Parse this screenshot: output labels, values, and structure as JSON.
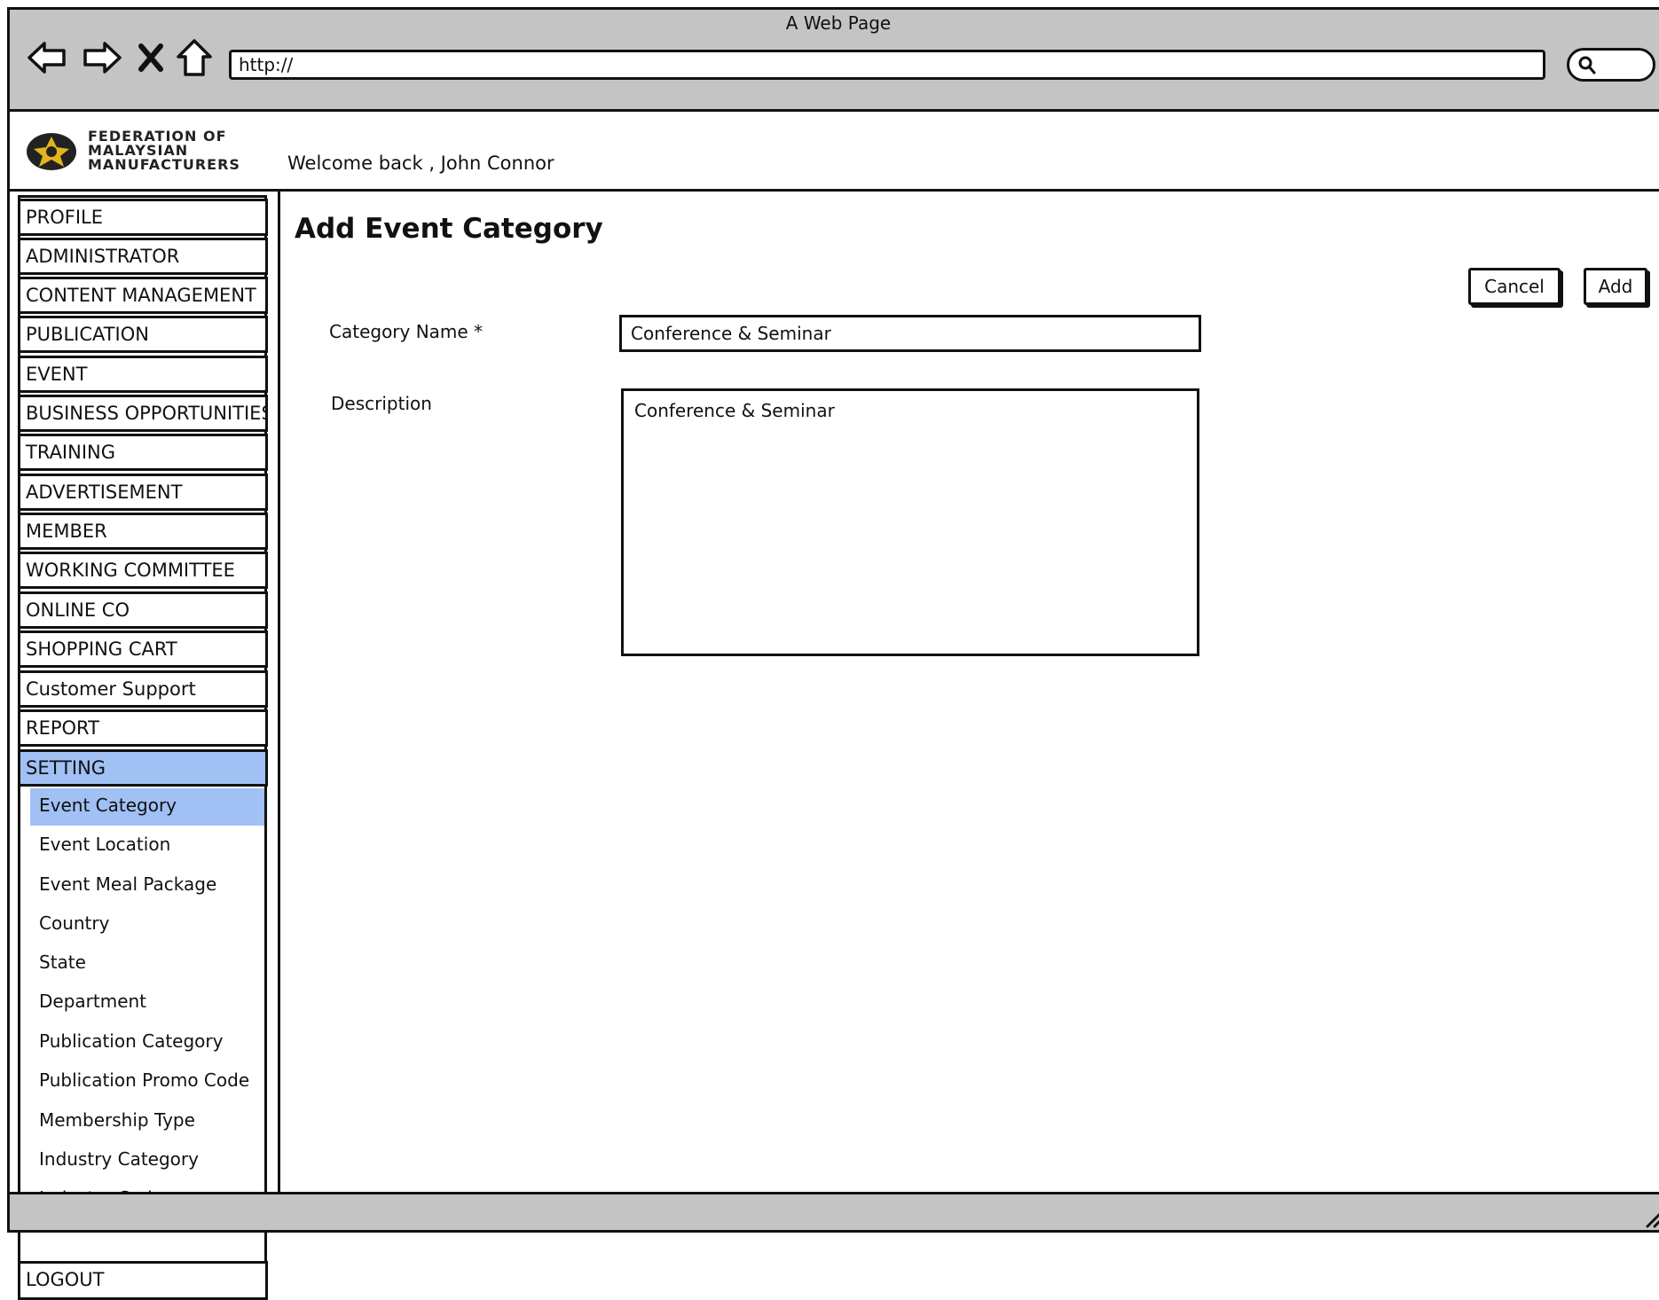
{
  "browser": {
    "title": "A Web Page",
    "url": "http://",
    "nav_icons": [
      "back-icon",
      "forward-icon",
      "close-icon",
      "home-icon"
    ],
    "search_icon": "search-icon"
  },
  "header": {
    "logo_lines": [
      "FEDERATION OF",
      "MALAYSIAN",
      "MANUFACTURERS"
    ],
    "welcome": "Welcome back , John Connor"
  },
  "sidebar": {
    "items": [
      {
        "label": "PROFILE"
      },
      {
        "label": "ADMINISTRATOR"
      },
      {
        "label": "CONTENT MANAGEMENT"
      },
      {
        "label": "PUBLICATION"
      },
      {
        "label": "EVENT"
      },
      {
        "label": "BUSINESS OPPORTUNITIES"
      },
      {
        "label": "TRAINING"
      },
      {
        "label": "ADVERTISEMENT"
      },
      {
        "label": "MEMBER"
      },
      {
        "label": "WORKING COMMITTEE"
      },
      {
        "label": "ONLINE CO"
      },
      {
        "label": "SHOPPING CART"
      },
      {
        "label": "Customer Support"
      },
      {
        "label": "REPORT"
      },
      {
        "label": "SETTING",
        "active": true
      }
    ],
    "sub_items": [
      {
        "label": "Event Category",
        "active": true
      },
      {
        "label": "Event Location"
      },
      {
        "label": "Event Meal Package"
      },
      {
        "label": "Country"
      },
      {
        "label": "State"
      },
      {
        "label": "Department"
      },
      {
        "label": "Publication Category"
      },
      {
        "label": "Publication Promo Code"
      },
      {
        "label": "Membership Type"
      },
      {
        "label": "Industry Category"
      },
      {
        "label": "Industry Code"
      }
    ],
    "logout": "LOGOUT"
  },
  "main": {
    "title": "Add Event Category",
    "cancel_label": "Cancel",
    "add_label": "Add",
    "category_name_label": "Category Name *",
    "category_name_value": "Conference & Seminar",
    "description_label": "Description",
    "description_value": "Conference & Seminar"
  },
  "colors": {
    "chrome": "#c4c4c4",
    "highlight": "#a1c0f4",
    "logo_gold": "#e3b51c"
  }
}
